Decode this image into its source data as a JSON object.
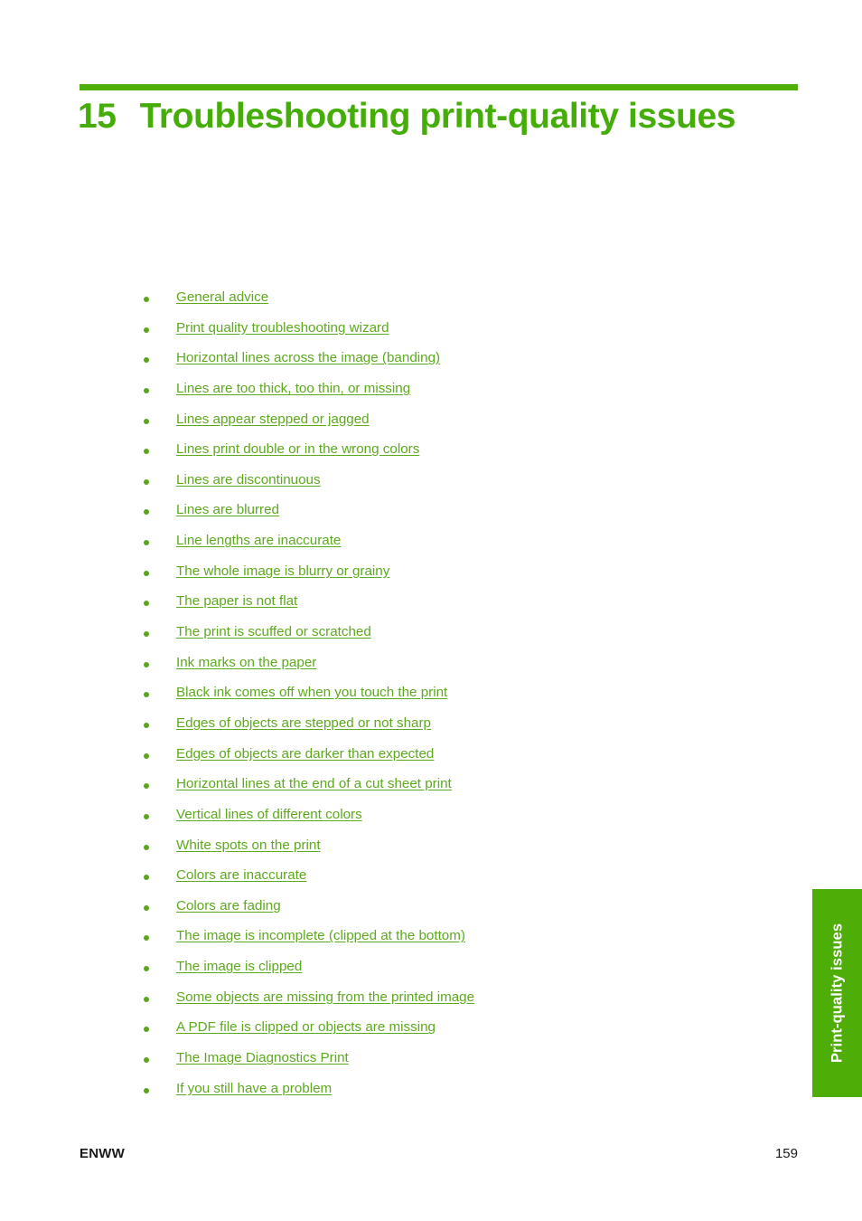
{
  "page": {
    "chapter_number": "15",
    "chapter_title": "Troubleshooting print-quality issues",
    "accent_color": "#4faf08",
    "link_color": "#5da91e",
    "tab_color": "#4fad07"
  },
  "toc": {
    "items": [
      {
        "label": "General advice"
      },
      {
        "label": "Print quality troubleshooting wizard"
      },
      {
        "label": "Horizontal lines across the image (banding)"
      },
      {
        "label": "Lines are too thick, too thin, or missing"
      },
      {
        "label": "Lines appear stepped or jagged"
      },
      {
        "label": "Lines print double or in the wrong colors"
      },
      {
        "label": "Lines are discontinuous"
      },
      {
        "label": "Lines are blurred"
      },
      {
        "label": "Line lengths are inaccurate"
      },
      {
        "label": "The whole image is blurry or grainy"
      },
      {
        "label": "The paper is not flat"
      },
      {
        "label": "The print is scuffed or scratched"
      },
      {
        "label": "Ink marks on the paper"
      },
      {
        "label": "Black ink comes off when you touch the print"
      },
      {
        "label": "Edges of objects are stepped or not sharp"
      },
      {
        "label": "Edges of objects are darker than expected"
      },
      {
        "label": "Horizontal lines at the end of a cut sheet print"
      },
      {
        "label": "Vertical lines of different colors"
      },
      {
        "label": "White spots on the print"
      },
      {
        "label": "Colors are inaccurate"
      },
      {
        "label": "Colors are fading"
      },
      {
        "label": "The image is incomplete (clipped at the bottom)"
      },
      {
        "label": "The image is clipped"
      },
      {
        "label": "Some objects are missing from the printed image"
      },
      {
        "label": "A PDF file is clipped or objects are missing"
      },
      {
        "label": "The Image Diagnostics Print"
      },
      {
        "label": "If you still have a problem"
      }
    ]
  },
  "side_tab": {
    "label": "Print-quality issues"
  },
  "footer": {
    "left": "ENWW",
    "page_number": "159"
  }
}
